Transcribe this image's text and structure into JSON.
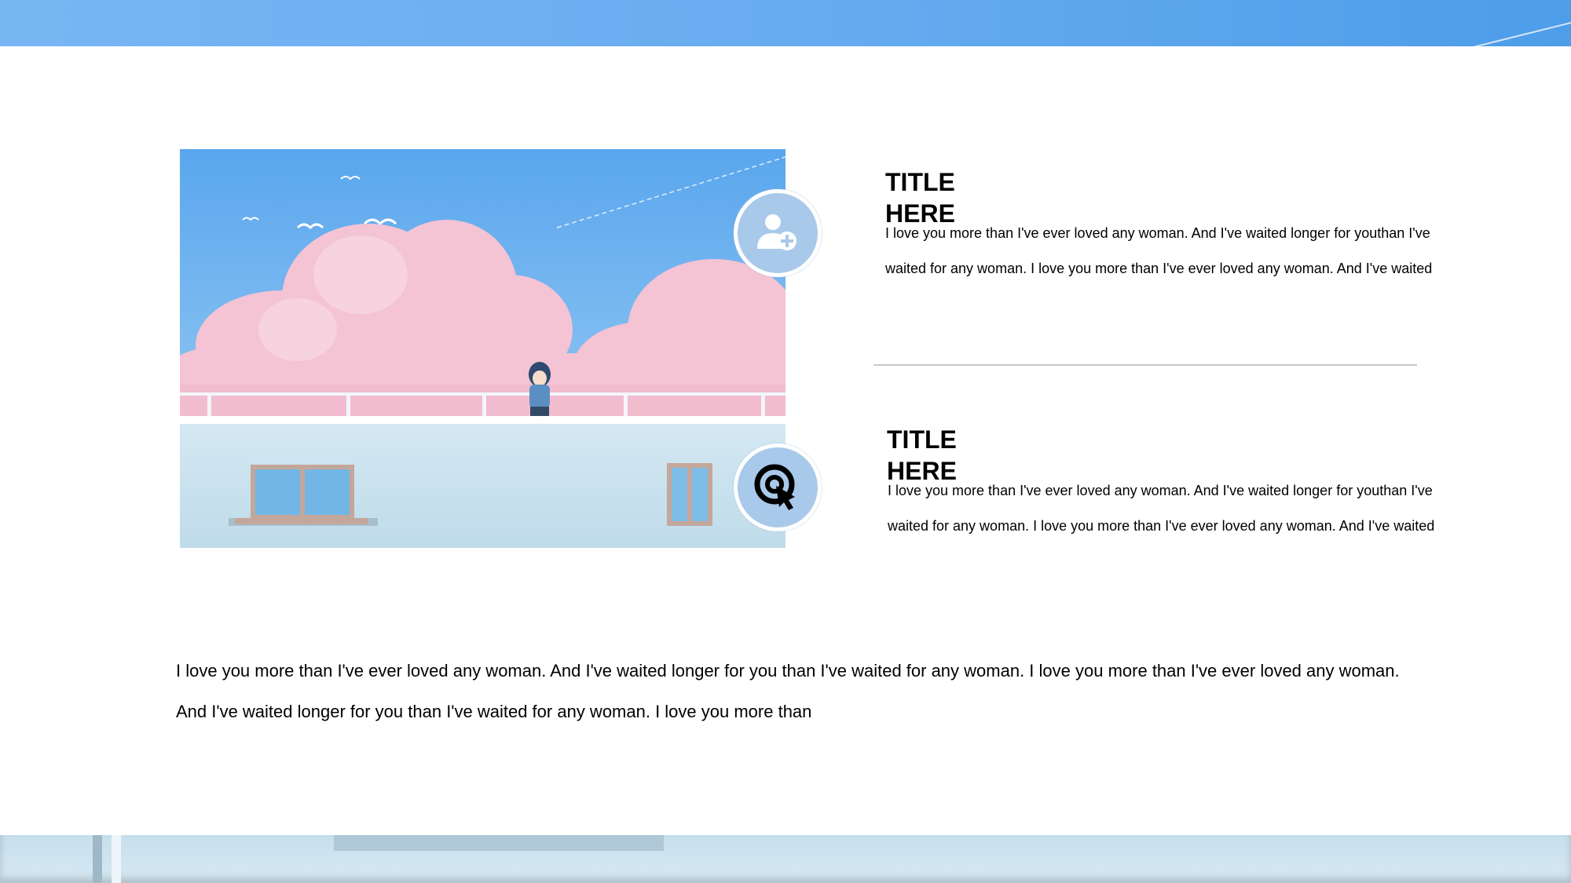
{
  "features": [
    {
      "title": "TITLE HERE",
      "body": "I love you more than I've ever loved any woman. And I've waited longer for youthan I've waited for any woman. I love you more than I've ever loved any woman. And I've waited",
      "icon": "add-user-icon"
    },
    {
      "title": "TITLE HERE",
      "body": "I love you more than I've ever loved any woman. And I've waited longer for youthan I've waited for any woman. I love you more than I've ever loved any woman. And I've waited",
      "icon": "target-icon"
    }
  ],
  "bottom_paragraph": "I love you more than I've ever loved any woman. And I've waited longer for you than I've waited for any woman. I love you more than I've ever loved any woman. And I've waited longer for you than I've waited for any woman. I love you more than",
  "colors": {
    "banner_blue": "#68acf0",
    "badge_blue": "#a9c9ea",
    "cloud_pink": "#f3c2d3",
    "wall_blue": "#cfe5f0",
    "divider_gray": "#c9c9c9"
  }
}
